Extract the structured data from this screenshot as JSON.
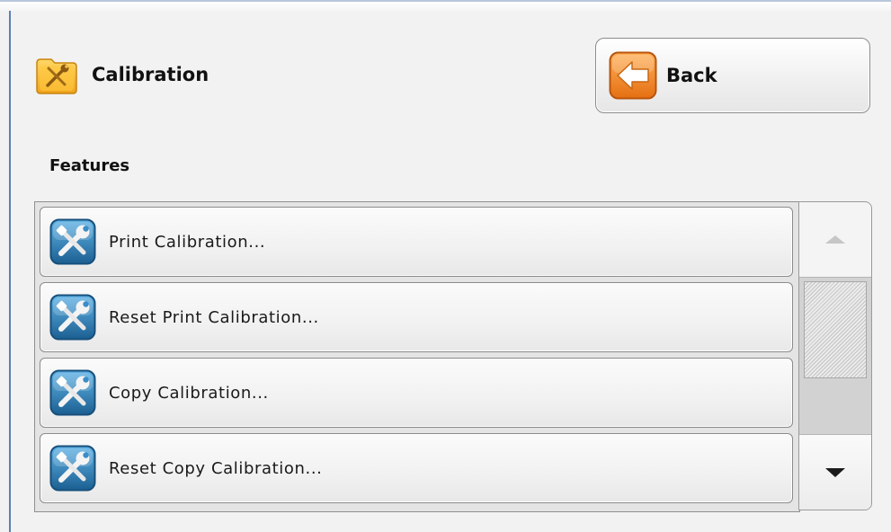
{
  "header": {
    "title": "Calibration",
    "icon": "folder-tools-icon"
  },
  "back_button": {
    "label": "Back",
    "icon": "arrow-left-icon"
  },
  "section": {
    "label": "Features"
  },
  "features": [
    {
      "label": "Print Calibration...",
      "icon": "tools-icon"
    },
    {
      "label": "Reset Print Calibration...",
      "icon": "tools-icon"
    },
    {
      "label": "Copy Calibration...",
      "icon": "tools-icon"
    },
    {
      "label": "Reset Copy Calibration...",
      "icon": "tools-icon"
    }
  ],
  "scrollbar": {
    "up_enabled": false,
    "down_enabled": true
  },
  "colors": {
    "frame_accent": "#5c80b6",
    "folder": "#f5b52c",
    "back_arrow_tile": "#ef8a25",
    "tool_tile": "#2a7db8"
  }
}
